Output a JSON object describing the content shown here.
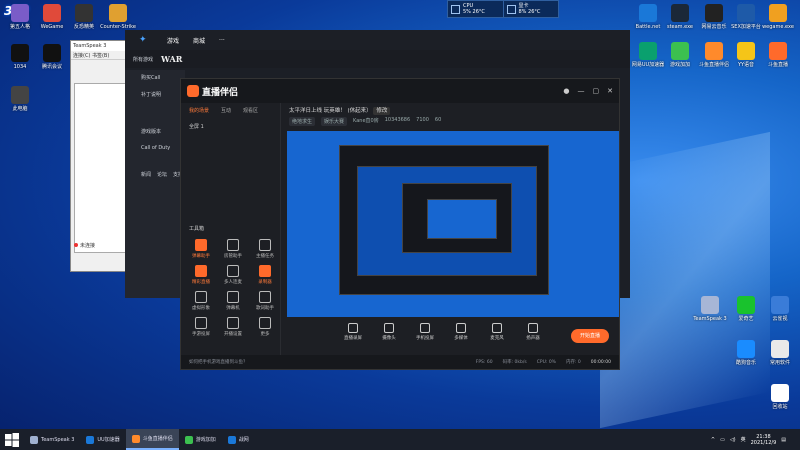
{
  "watermark": "3LP",
  "perf": {
    "cpu_label": "CPU",
    "cpu_value": "5% 26°C",
    "gpu_label": "显卡",
    "gpu_value": "8% 26°C"
  },
  "desktop_left": [
    {
      "label": "第五人格",
      "color": "#7a5cc8"
    },
    {
      "label": "WeGame",
      "color": "#e04a3a"
    },
    {
      "label": "反恐精英",
      "color": "#333"
    },
    {
      "label": "Counter-Strike",
      "color": "#e0a030"
    },
    {
      "label": "1034",
      "color": "#111"
    },
    {
      "label": "腾讯会议",
      "color": "#111"
    },
    {
      "label": "此电脑",
      "color": "#444"
    }
  ],
  "desktop_right": [
    {
      "label": "Battle.net",
      "color": "#1a78d8"
    },
    {
      "label": "steam.exe",
      "color": "#1b2838"
    },
    {
      "label": "网易云音乐",
      "color": "#222"
    },
    {
      "label": "SEX加速平台",
      "color": "#1e5aa8"
    },
    {
      "label": "wegame.exe",
      "color": "#f0a020"
    },
    {
      "label": "网易UU加速器",
      "color": "#0aa06e"
    },
    {
      "label": "游戏加加",
      "color": "#3cc050"
    },
    {
      "label": "斗鱼直播伴侣",
      "color": "#ff8a2b"
    },
    {
      "label": "YY语音",
      "color": "#f5c518"
    },
    {
      "label": "斗鱼直播",
      "color": "#ff6a2b"
    },
    {
      "label": "TeamSpeak 3",
      "color": "#a7b6d6"
    },
    {
      "label": "爱奇艺",
      "color": "#19c22d"
    },
    {
      "label": "云雀视",
      "color": "#3a7cd8"
    },
    {
      "label": "酷狗音乐",
      "color": "#1a8cff"
    },
    {
      "label": "常用软件",
      "color": "#e9e9e9"
    },
    {
      "label": "回收站",
      "color": "#ffffff"
    }
  ],
  "teamspeak": {
    "title": "TeamSpeak 3",
    "menu": "连接(C)  书签(B)",
    "status": "未连接"
  },
  "launcher": {
    "nav": [
      "游戏",
      "商城",
      "···"
    ],
    "sub": [
      "所有游戏",
      "WAR"
    ],
    "side": [
      "购买Call",
      "补丁说明",
      "游戏版本",
      "Call of Duty"
    ],
    "links": [
      "新闻",
      "论坛",
      "支持"
    ]
  },
  "douyu": {
    "brand": "直播伴侣",
    "tabs": [
      "我的场景",
      "互动",
      "观看区"
    ],
    "scene_item": "全屏 1",
    "room_title": "太平洋日上线 玩英雄！ (休起来）",
    "room_btn": "修改",
    "room_info": [
      "绝地求生",
      "娱乐大赛",
      "Kane直0房",
      "10343686",
      "7100",
      "60"
    ],
    "tools_title": "工具箱",
    "tools": [
      "弹幕助手",
      "房管助手",
      "主播任务",
      "精彩直播",
      "多人连麦",
      "录制器",
      "虚拟形象",
      "弹幕机",
      "歌词助手",
      "手游投屏",
      "开播设置",
      "更多"
    ],
    "toolbar": [
      "直播录屏",
      "摄像头",
      "手机投屏",
      "多媒体",
      "麦克风",
      "扬声器"
    ],
    "golive": "开始直播",
    "foot": {
      "tip": "如何把手机游戏直播到斗鱼？",
      "fps_label": "FPS: 60",
      "bitrate": "码率: 0kb/s",
      "cpu": "CPU: 0%",
      "mem": "内存: 0",
      "time": "00:00:00"
    }
  },
  "taskbar": {
    "items": [
      {
        "label": "TeamSpeak 3",
        "color": "#9fb0d0",
        "active": false
      },
      {
        "label": "UU加速器",
        "color": "#1a78d8",
        "active": false
      },
      {
        "label": "斗鱼直播伴侣",
        "color": "#ff8a2b",
        "active": true
      },
      {
        "label": "游戏加加",
        "color": "#3cc050",
        "active": false
      },
      {
        "label": "战网",
        "color": "#1a78d8",
        "active": false
      }
    ],
    "time": "21:38",
    "date": "2021/12/9",
    "ime": "英"
  }
}
